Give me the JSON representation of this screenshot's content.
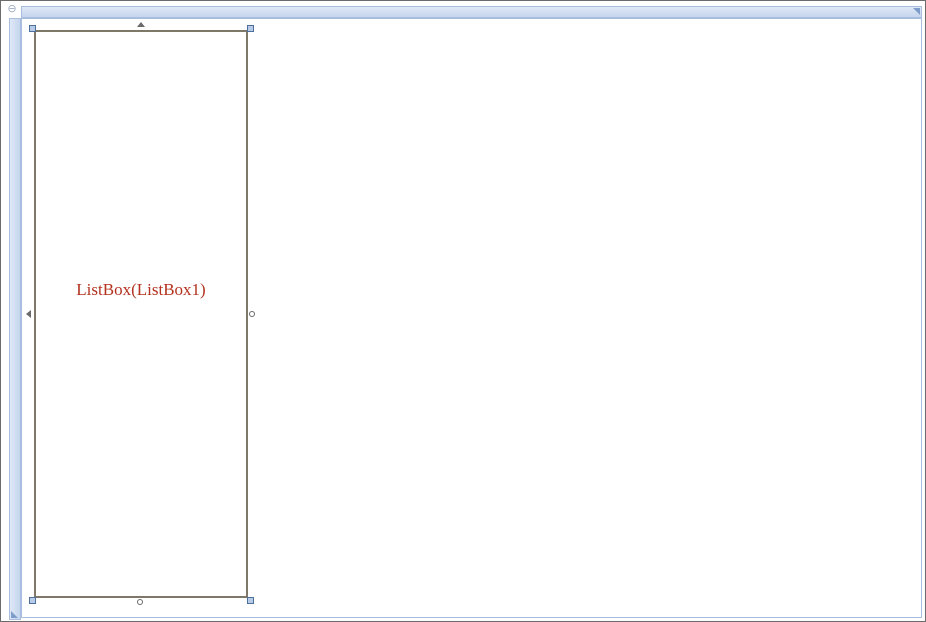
{
  "designer": {
    "corner_icon": "grip-icon",
    "accent_color": "#a9bedf"
  },
  "control": {
    "label": "ListBox(ListBox1)",
    "label_color": "#b4321f",
    "border_color": "#7d7868"
  }
}
